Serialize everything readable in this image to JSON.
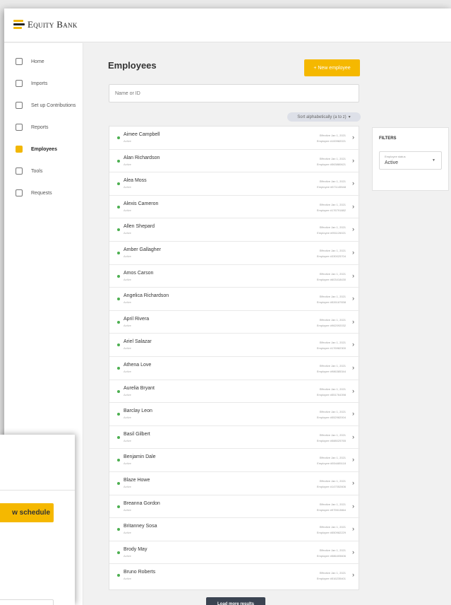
{
  "app": {
    "logo_text": "Equity Bank"
  },
  "sidebar": {
    "items": [
      {
        "label": "Home"
      },
      {
        "label": "Imports"
      },
      {
        "label": "Set up Contributions"
      },
      {
        "label": "Reports"
      },
      {
        "label": "Employees",
        "active": true
      },
      {
        "label": "Tools"
      },
      {
        "label": "Requests"
      }
    ]
  },
  "main": {
    "title": "Employees",
    "new_button": "+ New employee",
    "search_placeholder": "Name or ID",
    "sort_label": "Sort alphabetically (a to z)",
    "load_more": "Load more results"
  },
  "filters": {
    "title": "FILTERS",
    "field_label": "Employee status",
    "field_value": "Active"
  },
  "employees": [
    {
      "name": "Aimee Campbell",
      "status": "Active",
      "effective": "Effective Jan 1, 2021",
      "number": "Employee #100982021"
    },
    {
      "name": "Alan Richardson",
      "status": "Active",
      "effective": "Effective Jan 1, 2021",
      "number": "Employee #563880621"
    },
    {
      "name": "Alea Moss",
      "status": "Active",
      "effective": "Effective Jan 1, 2021",
      "number": "Employee #571145548"
    },
    {
      "name": "Alexis Cameron",
      "status": "Active",
      "effective": "Effective Jan 1, 2021",
      "number": "Employee #176791882"
    },
    {
      "name": "Allen Shepard",
      "status": "Active",
      "effective": "Effective Jan 1, 2021",
      "number": "Employee #951126021"
    },
    {
      "name": "Amber Gallagher",
      "status": "Active",
      "effective": "Effective Jan 1, 2021",
      "number": "Employee #330025704"
    },
    {
      "name": "Amos Carson",
      "status": "Active",
      "effective": "Effective Jan 1, 2021",
      "number": "Employee #603418430"
    },
    {
      "name": "Angelica Richardson",
      "status": "Active",
      "effective": "Effective Jan 1, 2021",
      "number": "Employee #526187838"
    },
    {
      "name": "April Rivera",
      "status": "Active",
      "effective": "Effective Jan 1, 2021",
      "number": "Employee #962092032"
    },
    {
      "name": "Ariel Salazar",
      "status": "Active",
      "effective": "Effective Jan 1, 2021",
      "number": "Employee #176982300"
    },
    {
      "name": "Athena Love",
      "status": "Active",
      "effective": "Effective Jan 1, 2021",
      "number": "Employee #986385344"
    },
    {
      "name": "Aurelia Bryant",
      "status": "Active",
      "effective": "Effective Jan 1, 2021",
      "number": "Employee #551764398"
    },
    {
      "name": "Barclay Leon",
      "status": "Active",
      "effective": "Effective Jan 1, 2021",
      "number": "Employee #552982004"
    },
    {
      "name": "Basil Gilbert",
      "status": "Active",
      "effective": "Effective Jan 1, 2021",
      "number": "Employee #588025765"
    },
    {
      "name": "Benjamin Dale",
      "status": "Active",
      "effective": "Effective Jan 1, 2021",
      "number": "Employee #554485118"
    },
    {
      "name": "Blaze Howe",
      "status": "Active",
      "effective": "Effective Jan 1, 2021",
      "number": "Employee #147052606"
    },
    {
      "name": "Breanna Gordon",
      "status": "Active",
      "effective": "Effective Jan 1, 2021",
      "number": "Employee #975513864"
    },
    {
      "name": "Britanney Sosa",
      "status": "Active",
      "effective": "Effective Jan 1, 2021",
      "number": "Employee #550982229"
    },
    {
      "name": "Brody May",
      "status": "Active",
      "effective": "Effective Jan 1, 2021",
      "number": "Employee #586405606"
    },
    {
      "name": "Bruno Roberts",
      "status": "Active",
      "effective": "Effective Jan 1, 2021",
      "number": "Employee #516235401"
    }
  ],
  "popup": {
    "button_label": "w schedule"
  },
  "colors": {
    "accent": "#f5b800",
    "dark_button": "#3b4452",
    "active_dot": "#4caf50"
  },
  "icons": {
    "sidebar": [
      "home-icon",
      "import-icon",
      "contributions-icon",
      "reports-icon",
      "employees-icon",
      "tools-icon",
      "requests-icon"
    ]
  }
}
